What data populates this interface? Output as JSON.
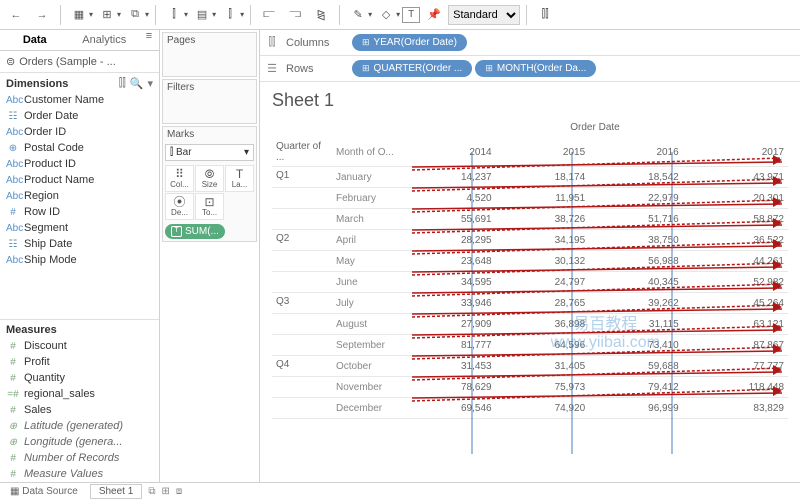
{
  "toolbar": {
    "std_label": "Standard"
  },
  "tabs": {
    "data": "Data",
    "analytics": "Analytics"
  },
  "datasource": {
    "name": "Orders (Sample - ..."
  },
  "dimensions": {
    "title": "Dimensions",
    "items": [
      {
        "type": "Abc",
        "label": "Customer Name"
      },
      {
        "type": "date",
        "label": "Order Date"
      },
      {
        "type": "Abc",
        "label": "Order ID"
      },
      {
        "type": "geo",
        "label": "Postal Code"
      },
      {
        "type": "Abc",
        "label": "Product ID"
      },
      {
        "type": "Abc",
        "label": "Product Name"
      },
      {
        "type": "Abc",
        "label": "Region"
      },
      {
        "type": "num",
        "label": "Row ID"
      },
      {
        "type": "Abc",
        "label": "Segment"
      },
      {
        "type": "date",
        "label": "Ship Date"
      },
      {
        "type": "Abc",
        "label": "Ship Mode"
      }
    ]
  },
  "measures": {
    "title": "Measures",
    "items": [
      {
        "type": "num",
        "label": "Discount",
        "italic": false
      },
      {
        "type": "num",
        "label": "Profit",
        "italic": false
      },
      {
        "type": "num",
        "label": "Quantity",
        "italic": false
      },
      {
        "type": "calc",
        "label": "regional_sales",
        "italic": false
      },
      {
        "type": "num",
        "label": "Sales",
        "italic": false
      },
      {
        "type": "geo",
        "label": "Latitude (generated)",
        "italic": true
      },
      {
        "type": "geo",
        "label": "Longitude (genera...",
        "italic": true
      },
      {
        "type": "num",
        "label": "Number of Records",
        "italic": true
      },
      {
        "type": "num",
        "label": "Measure Values",
        "italic": true
      }
    ]
  },
  "cards": {
    "pages": "Pages",
    "filters": "Filters",
    "marks": "Marks",
    "mark_type_icon": "⫿",
    "mark_type": "Bar",
    "cells": [
      {
        "i": "⠿",
        "l": "Col..."
      },
      {
        "i": "⦾",
        "l": "Size"
      },
      {
        "i": "T",
        "l": "La..."
      },
      {
        "i": "⦿",
        "l": "De..."
      },
      {
        "i": "⊡",
        "l": "To..."
      }
    ],
    "sum_pill": "SUM(..."
  },
  "shelves": {
    "columns_label": "Columns",
    "rows_label": "Rows",
    "columns": [
      {
        "label": "YEAR(Order Date)"
      }
    ],
    "rows": [
      {
        "label": "QUARTER(Order ..."
      },
      {
        "label": "MONTH(Order Da..."
      }
    ]
  },
  "viz": {
    "title": "Sheet 1",
    "super_header": "Order Date",
    "col_q": "Quarter of ...",
    "col_m": "Month of O...",
    "years": [
      "2014",
      "2015",
      "2016",
      "2017"
    ],
    "rows": [
      {
        "q": "Q1",
        "m": "January",
        "v": [
          "14,237",
          "18,174",
          "18,542",
          "43,971"
        ]
      },
      {
        "q": "",
        "m": "February",
        "v": [
          "4,520",
          "11,951",
          "22,979",
          "20,301"
        ]
      },
      {
        "q": "",
        "m": "March",
        "v": [
          "55,691",
          "38,726",
          "51,716",
          "58,872"
        ]
      },
      {
        "q": "Q2",
        "m": "April",
        "v": [
          "28,295",
          "34,195",
          "38,750",
          "36,522"
        ]
      },
      {
        "q": "",
        "m": "May",
        "v": [
          "23,648",
          "30,132",
          "56,988",
          "44,261"
        ]
      },
      {
        "q": "",
        "m": "June",
        "v": [
          "34,595",
          "24,797",
          "40,345",
          "52,982"
        ]
      },
      {
        "q": "Q3",
        "m": "July",
        "v": [
          "33,946",
          "28,765",
          "39,262",
          "45,264"
        ]
      },
      {
        "q": "",
        "m": "August",
        "v": [
          "27,909",
          "36,898",
          "31,115",
          "63,121"
        ]
      },
      {
        "q": "",
        "m": "September",
        "v": [
          "81,777",
          "64,596",
          "73,410",
          "87,867"
        ]
      },
      {
        "q": "Q4",
        "m": "October",
        "v": [
          "31,453",
          "31,405",
          "59,688",
          "77,777"
        ]
      },
      {
        "q": "",
        "m": "November",
        "v": [
          "78,629",
          "75,973",
          "79,412",
          "118,448"
        ]
      },
      {
        "q": "",
        "m": "December",
        "v": [
          "69,546",
          "74,920",
          "96,999",
          "83,829"
        ]
      }
    ]
  },
  "status": {
    "data_source": "Data Source",
    "sheet": "Sheet 1"
  },
  "watermark": {
    "l1": "易百教程",
    "l2": "www.yiibai.com"
  }
}
